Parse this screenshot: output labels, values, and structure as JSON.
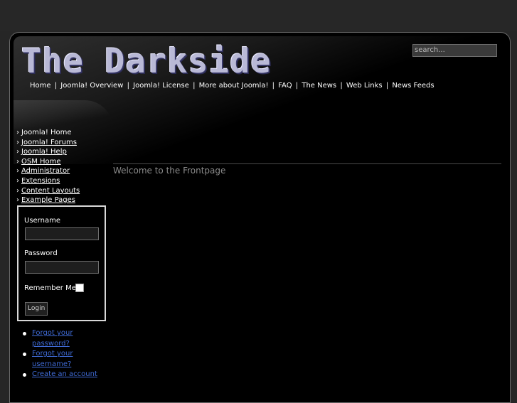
{
  "header": {
    "site_title": "The Darkside",
    "search_placeholder": "search..."
  },
  "topnav": {
    "items": [
      "Home",
      "Joomla! Overview",
      "Joomla! License",
      "More about Joomla!",
      "FAQ",
      "The News",
      "Web Links",
      "News Feeds"
    ],
    "separator": "|"
  },
  "sidemenu": {
    "arrow": "›",
    "items": [
      {
        "label": "Joomla! Home",
        "underlined": false
      },
      {
        "label": "Joomla! Forums",
        "underlined": true
      },
      {
        "label": "Joomla! Help",
        "underlined": true
      },
      {
        "label": "OSM Home",
        "underlined": true
      },
      {
        "label": "Administrator",
        "underlined": true
      },
      {
        "label": "Extensions",
        "underlined": true
      },
      {
        "label": "Content Layouts",
        "underlined": true
      },
      {
        "label": "Example Pages",
        "underlined": true
      }
    ]
  },
  "login": {
    "username_label": "Username",
    "password_label": "Password",
    "remember_label": "Remember Me",
    "button_label": "Login",
    "links": [
      "Forgot your password?",
      "Forgot your username?",
      "Create an account"
    ]
  },
  "main": {
    "welcome": "Welcome to the Frontpage"
  },
  "colors": {
    "background": "#262626",
    "frame": "#000000",
    "link": "#3f6bd6",
    "logo": "#b9b9d6",
    "welcome_text": "#8a8a8a"
  }
}
